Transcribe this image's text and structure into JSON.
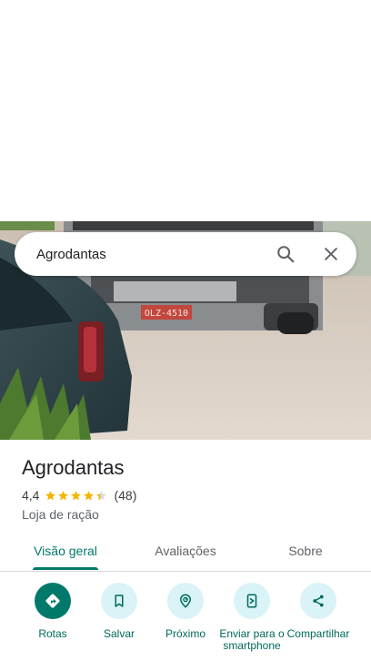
{
  "search": {
    "query": "Agrodantas"
  },
  "place": {
    "title": "Agrodantas",
    "rating_text": "4,4",
    "rating_value": 4.4,
    "review_count": "(48)",
    "category": "Loja de ração"
  },
  "tabs": [
    {
      "label": "Visão geral",
      "active": true
    },
    {
      "label": "Avaliações",
      "active": false
    },
    {
      "label": "Sobre",
      "active": false
    }
  ],
  "actions": [
    {
      "label": "Rotas",
      "icon": "directions-icon",
      "primary": true
    },
    {
      "label": "Salvar",
      "icon": "bookmark-icon",
      "primary": false
    },
    {
      "label": "Próximo",
      "icon": "nearby-icon",
      "primary": false
    },
    {
      "label": "Enviar para o smartphone",
      "icon": "send-to-phone-icon",
      "primary": false
    },
    {
      "label": "Compartilhar",
      "icon": "share-icon",
      "primary": false
    }
  ],
  "photo": {
    "plate": "OLZ-4510"
  },
  "colors": {
    "accent": "#00796b",
    "action_bg": "#d9f3f7",
    "star": "#f4b400"
  }
}
